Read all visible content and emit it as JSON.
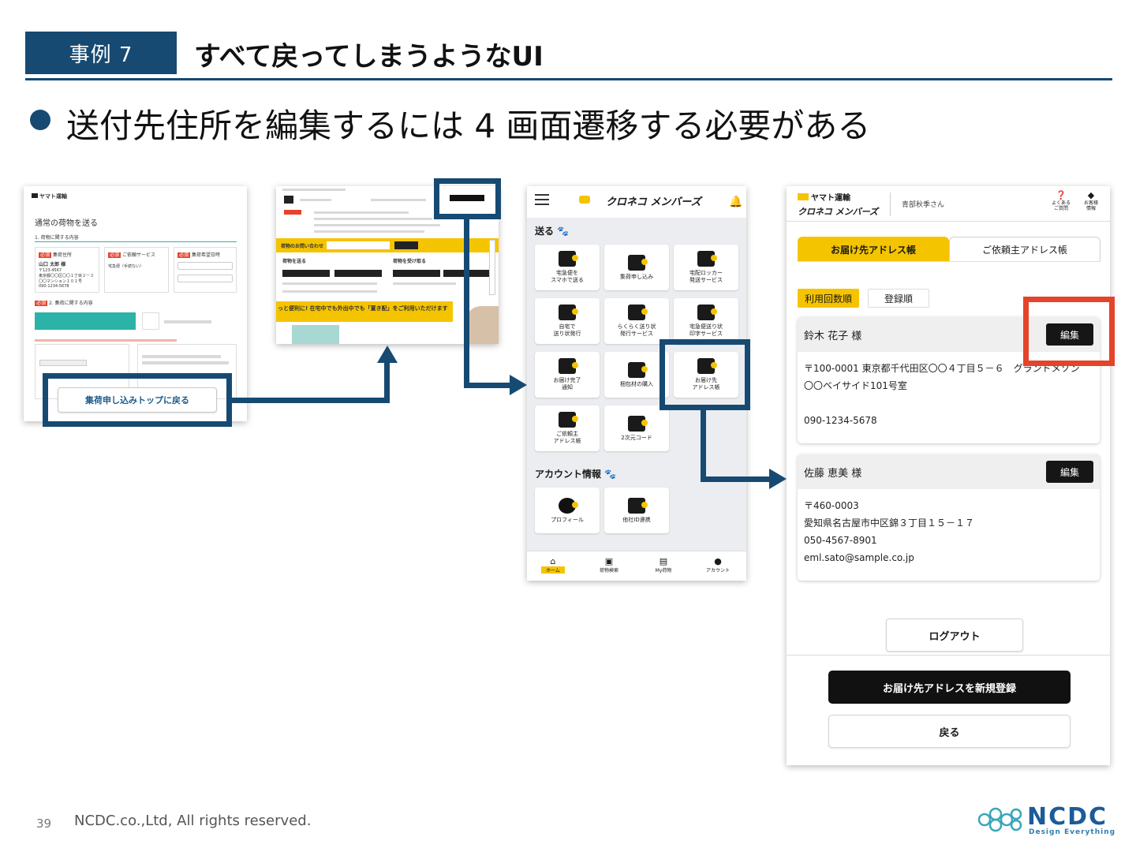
{
  "header": {
    "case_label": "事例 7",
    "title": "すべて戻ってしまうようなUI"
  },
  "bullet": {
    "text": "送付先住所を編集するには 4 画面遷移する必要がある"
  },
  "screen1": {
    "brand": "ヤマト運輸",
    "heading": "通常の荷物を送る",
    "section1": "1. 荷物に関する内容",
    "col_sender": "集荷住所",
    "col_service": "ご依頼サービス",
    "col_date": "集荷希望日時",
    "sender_name": "山口 太郎 様",
    "sender_lines": [
      "〒123-4567",
      "東京都〇〇区〇〇１丁目２ー３",
      "〇〇マンション１０１号",
      "090-1234-5678"
    ],
    "service_value": "宅急便（手続ない）",
    "section2": "2. 集荷に関する内容",
    "back_button": "集荷申し込みトップに戻る"
  },
  "screen2": {
    "search_label": "荷物のお問い合わせ",
    "send_label": "荷物を送る",
    "receive_label": "荷物を受け取る",
    "banner": "っと便利に! 在宅中でも外出中でも「置き配」をご利用いただけます",
    "login_button": "クロネコメンバーズ"
  },
  "screen3": {
    "app_title": "クロネコ メンバーズ",
    "send_section": "送る",
    "tiles": [
      "宅急便を\nスマホで送る",
      "集荷申し込み",
      "宅配ロッカー\n発送サービス",
      "自宅で\n送り状発行",
      "らくらく送り状\n発行サービス",
      "宅急便送り状\n印字サービス",
      "お届け完了\n通知",
      "梱包材の購入",
      "お届け先\nアドレス帳",
      "ご依頼主\nアドレス帳",
      "2次元コード"
    ],
    "account_section": "アカウント情報",
    "account_tiles": [
      "プロフィール",
      "他社ID連携"
    ],
    "nav": [
      "ホーム",
      "荷物検索",
      "My荷物",
      "アカウント"
    ]
  },
  "screen4": {
    "brand": "ヤマト運輸",
    "app_name": "クロネコ メンバーズ",
    "user_name": "青部秋季さん",
    "help_label": "よくある\nご質問",
    "member_label": "お客様\n情報",
    "tab_active": "お届け先アドレス帳",
    "tab_inactive": "ご依頼主アドレス帳",
    "sort_active": "利用回数順",
    "sort_inactive": "登録順",
    "edit_label": "編集",
    "entries": [
      {
        "name": "鈴木 花子 様",
        "lines": [
          "〒100-0001 東京都千代田区〇〇４丁目５－６　グランドメゾン",
          "〇〇ベイサイド101号室",
          "",
          "090-1234-5678"
        ]
      },
      {
        "name": "佐藤 恵美 様",
        "lines": [
          "〒460-0003",
          "愛知県名古屋市中区錦３丁目１５－１７",
          "050-4567-8901",
          "eml.sato@sample.co.jp"
        ]
      }
    ],
    "logout": "ログアウト",
    "register": "お届け先アドレスを新規登録",
    "back": "戻る"
  },
  "footer": {
    "page_number": "39",
    "copyright": "NCDC.co.,Ltd, All rights reserved.",
    "logo": "NCDC",
    "logo_sub": "Design Everything"
  },
  "colors": {
    "navy": "#164a72",
    "highlight_red": "#e5432a",
    "brand_yellow": "#f5c400"
  }
}
